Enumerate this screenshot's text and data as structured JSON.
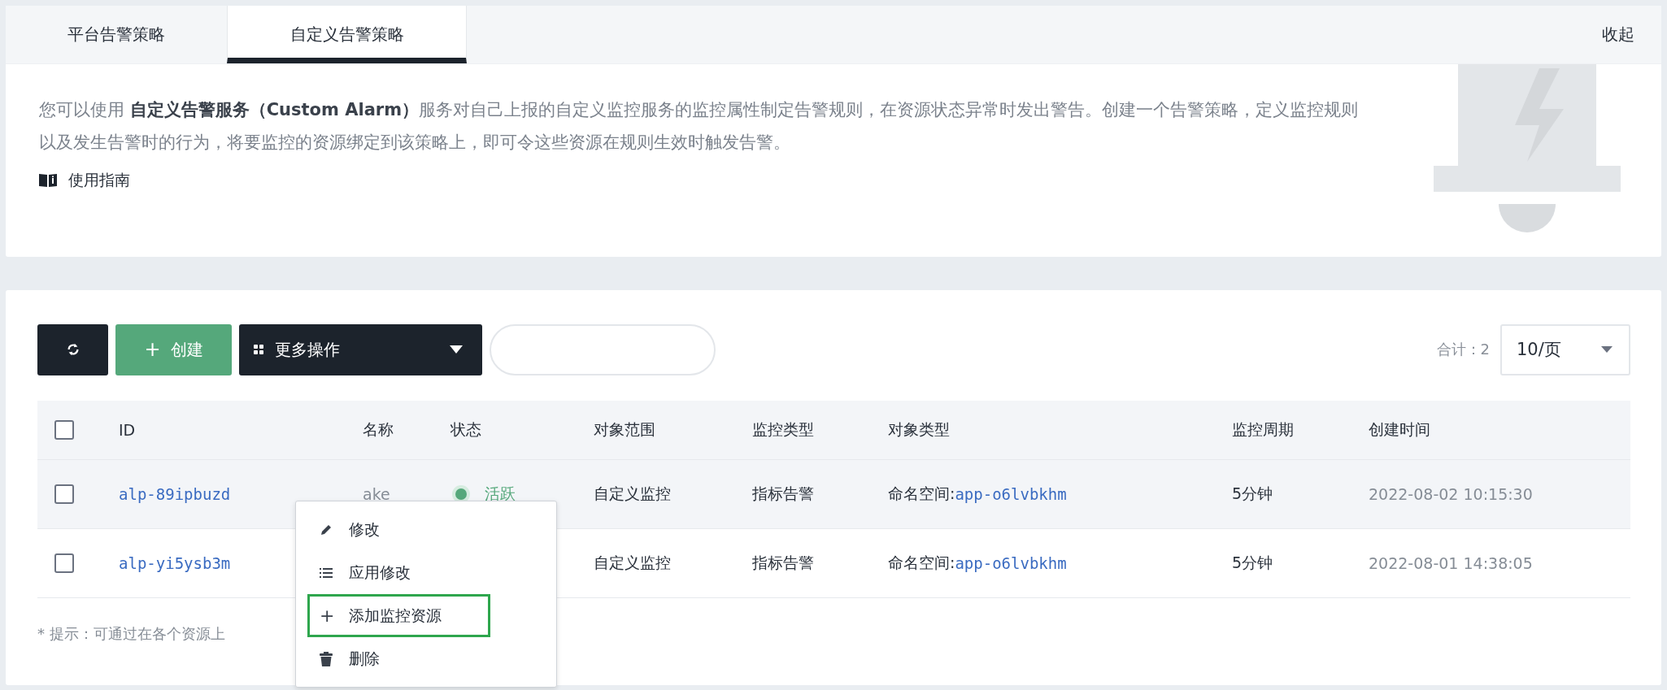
{
  "tabs": [
    {
      "label": "平台告警策略",
      "selected": false
    },
    {
      "label": "自定义告警策略",
      "selected": true
    }
  ],
  "collapse": "收起",
  "intro": {
    "text": "您可以使用 **自定义告警服务（Custom Alarm）**服务对自己上报的自定义监控服务的监控属性制定告警规则，在资源状态异常时发出警告。创建一个告警策略，定义监控规则以及发生告警时的行为，将要监控的资源绑定到该策略上，即可令这些资源在规则生效时触发告警。",
    "guide": "使用指南"
  },
  "toolbar": {
    "create": "创建",
    "create_icon": "+",
    "more": "更多操作",
    "total": "合计：2",
    "page_size": "10/页"
  },
  "table": {
    "all_checked": false,
    "columns": [
      "ID",
      "名称",
      "状态",
      "对象范围",
      "监控类型",
      "对象类型",
      "监控周期",
      "创建时间"
    ],
    "rows": [
      {
        "checked": false,
        "hovered": true,
        "id": "alp-89ipbuzd",
        "name": "ake",
        "status": "活跃",
        "scope": "自定义监控",
        "monitor_type": "指标告警",
        "object_prefix": "命名空间:",
        "object_link": "app-o6lvbkhm",
        "period": "5分钟",
        "created": "2022-08-02 10:15:30"
      },
      {
        "checked": false,
        "hovered": false,
        "id": "alp-yi5ysb3m",
        "scope": "自定义监控",
        "monitor_type": "指标告警",
        "object_prefix": "命名空间:",
        "object_link": "app-o6lvbkhm",
        "period": "5分钟",
        "created": "2022-08-01 14:38:05"
      }
    ]
  },
  "context_menu": [
    {
      "kind": "edit",
      "label": "修改",
      "selected": false
    },
    {
      "kind": "list",
      "label": "应用修改",
      "selected": false
    },
    {
      "kind": "add",
      "icon": "+",
      "label": "添加监控资源",
      "selected": true
    },
    {
      "kind": "delete",
      "label": "删除",
      "selected": false
    }
  ],
  "hint": "* 提示：可通过在各个资源上"
}
